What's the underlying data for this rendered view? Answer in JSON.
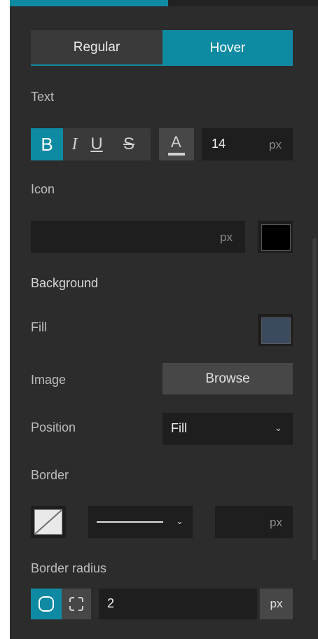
{
  "tabs": {
    "regular": "Regular",
    "hover": "Hover"
  },
  "text_section": {
    "title": "Text",
    "bold": "B",
    "italic": "I",
    "underline": "U",
    "strike": "S",
    "color_letter": "A",
    "size_value": "14",
    "size_unit": "px"
  },
  "icon_section": {
    "title": "Icon",
    "size_value": "",
    "size_unit": "px",
    "color": "#000000"
  },
  "background_section": {
    "title": "Background",
    "fill_label": "Fill",
    "fill_color": "#3b4a5e",
    "image_label": "Image",
    "browse_label": "Browse",
    "position_label": "Position",
    "position_value": "Fill"
  },
  "border_section": {
    "title": "Border",
    "width_value": "",
    "width_unit": "px"
  },
  "radius_section": {
    "title": "Border radius",
    "value": "2",
    "unit": "px"
  },
  "colors": {
    "accent": "#0f8aa3",
    "panel": "#2c2c2c"
  }
}
